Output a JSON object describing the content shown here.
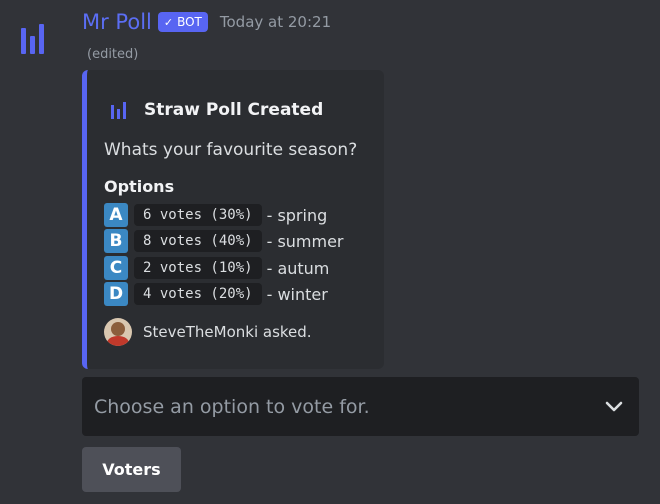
{
  "author": {
    "name": "Mr Poll",
    "badge": "BOT",
    "badge_check": "✓",
    "timestamp": "Today at 20:21",
    "edited": "(edited)",
    "avatar_icon": "poll-bars-icon"
  },
  "embed": {
    "title": "Straw Poll Created",
    "title_icon": "poll-bars-icon",
    "question": "Whats your favourite season?",
    "options_label": "Options",
    "options": [
      {
        "letter": "A",
        "votes": "6 votes (30%)",
        "label": "- spring"
      },
      {
        "letter": "B",
        "votes": "8 votes (40%)",
        "label": "- summer"
      },
      {
        "letter": "C",
        "votes": "2 votes (10%)",
        "label": "- autum"
      },
      {
        "letter": "D",
        "votes": "4 votes (20%)",
        "label": "- winter"
      }
    ],
    "footer": "SteveTheMonki asked.",
    "accent_color": "#5865f2"
  },
  "select": {
    "placeholder": "Choose an option to vote for.",
    "icon": "chevron-down-icon"
  },
  "voters_button": {
    "label": "Voters"
  }
}
